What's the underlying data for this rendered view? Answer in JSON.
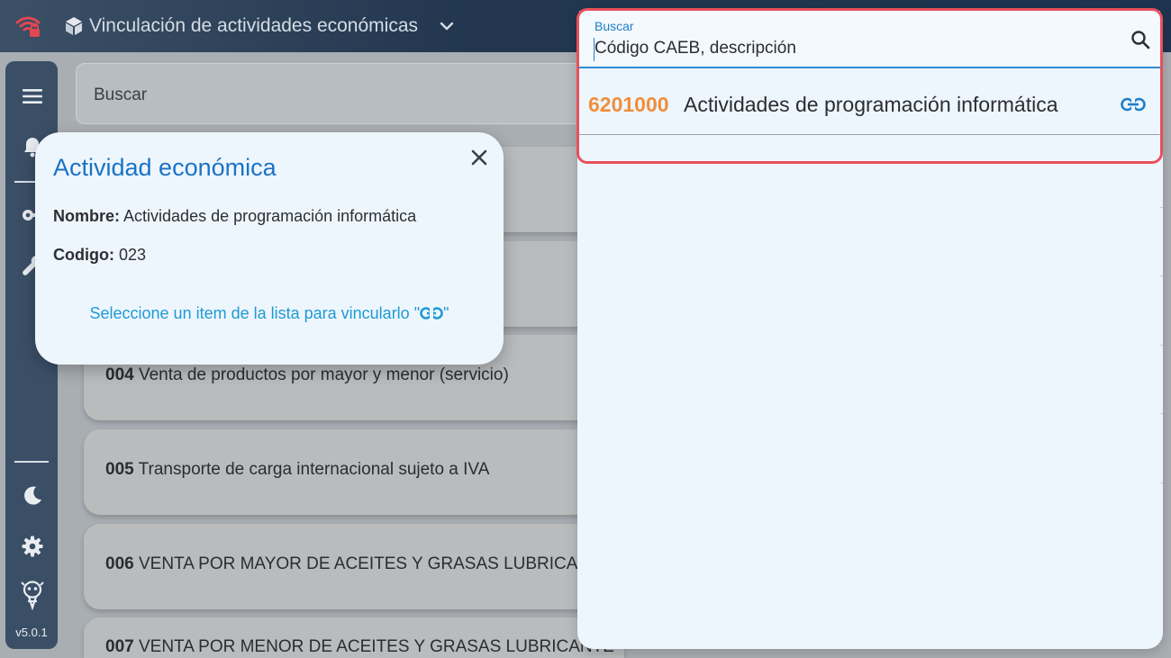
{
  "app": {
    "title": "Vinculación de actividades económicas",
    "version": "v5.0.1"
  },
  "icons": {
    "wifi": "wifi-warning-icon",
    "cube": "cube-icon",
    "chevron": "chevron-down-icon",
    "menu": "menu-icon",
    "bell": "bell-icon",
    "key": "key-icon",
    "wrench": "wrench-icon",
    "moon": "moon-icon",
    "gear": "gear-icon",
    "logo": "mascot-logo-icon",
    "close": "close-icon",
    "search": "search-icon",
    "link": "link-icon"
  },
  "main_search": {
    "placeholder": "Buscar"
  },
  "list": {
    "items": [
      {
        "code": "004",
        "label": "Venta de productos por mayor y menor (servicio)"
      },
      {
        "code": "005",
        "label": "Transporte de carga internacional sujeto a IVA"
      },
      {
        "code": "006",
        "label": "VENTA POR MAYOR DE ACEITES Y GRASAS LUBRICANT"
      },
      {
        "code": "007",
        "label": "VENTA POR MENOR DE ACEITES Y GRASAS LUBRICANTE"
      }
    ]
  },
  "modal": {
    "title": "Actividad económica",
    "name_label": "Nombre:",
    "name_value": "Actividades de programación informática",
    "code_label": "Codigo:",
    "code_value": "023",
    "hint_before": "Seleccione un item de la lista para vincularlo \"",
    "hint_after": "\""
  },
  "search_panel": {
    "label": "Buscar",
    "value": "Código CAEB, descripción",
    "results": [
      {
        "code": "6201000",
        "description": "Actividades de programación informática"
      }
    ]
  },
  "colors": {
    "accent_blue": "#1a73c6",
    "code_orange": "#ef8f3c",
    "highlight_red": "#e8505b",
    "topbar": "#22374f"
  }
}
